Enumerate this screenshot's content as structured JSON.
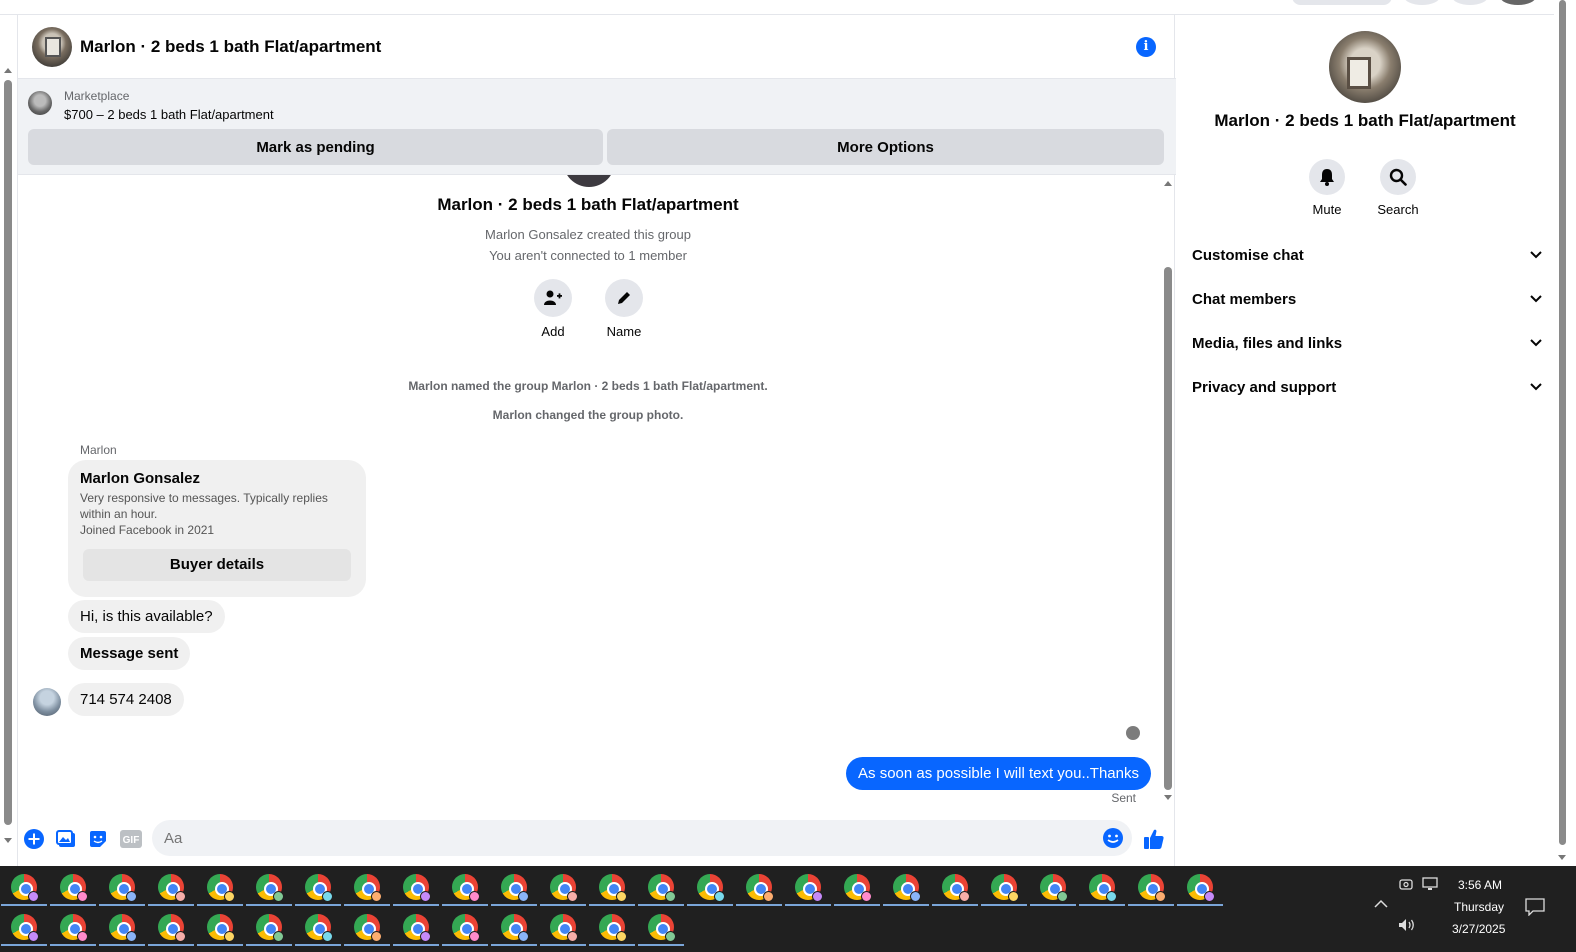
{
  "header": {
    "title": "Marlon · 2 beds 1 bath Flat/apartment"
  },
  "marketplace": {
    "label": "Marketplace",
    "listing": "$700 – 2 beds 1 bath Flat/apartment",
    "mark_pending": "Mark as pending",
    "more_options": "More Options"
  },
  "conversation": {
    "group_title": "Marlon · 2 beds 1 bath Flat/apartment",
    "created": "Marlon Gonsalez created this group",
    "connected": "You aren't connected to 1 member",
    "add_label": "Add",
    "name_label": "Name",
    "system_1": "Marlon named the group Marlon · 2 beds 1 bath Flat/apartment.",
    "system_2": "Marlon changed the group photo.",
    "sender": "Marlon",
    "card": {
      "name": "Marlon Gonsalez",
      "desc_1": "Very responsive to messages. Typically replies within an hour.",
      "desc_2": "Joined Facebook in 2021",
      "button": "Buyer details"
    },
    "incoming": [
      {
        "text": "Hi, is this available?",
        "bold": false
      },
      {
        "text": "Message sent",
        "bold": true
      },
      {
        "text": "714 574 2408",
        "bold": false
      }
    ],
    "outgoing": "As soon as possible I will text you..Thanks",
    "status": "Sent"
  },
  "composer": {
    "placeholder": "Aa",
    "gif_label": "GIF"
  },
  "sidebar": {
    "title": "Marlon · 2 beds 1 bath Flat/apartment",
    "mute_label": "Mute",
    "search_label": "Search",
    "sections": [
      "Customise chat",
      "Chat members",
      "Media, files and links",
      "Privacy and support"
    ]
  },
  "taskbar": {
    "time": "3:56 AM",
    "day": "Thursday",
    "date": "3/27/2025"
  },
  "colors": {
    "accent": "#0866ff",
    "bubble_in": "#f0f0f0",
    "taskbar": "#202020"
  }
}
